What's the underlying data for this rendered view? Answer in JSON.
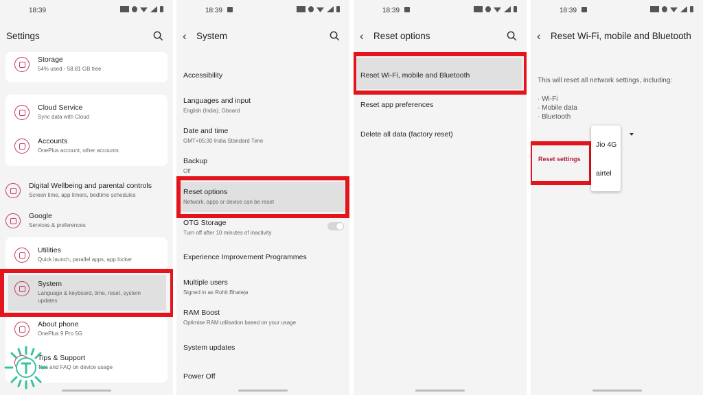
{
  "status_time": "18:39",
  "settings": {
    "title": "Settings",
    "items": [
      {
        "title": "Storage",
        "subtitle": "54% used - 58.81 GB free"
      },
      {
        "title": "Cloud Service",
        "subtitle": "Sync data with Cloud"
      },
      {
        "title": "Accounts",
        "subtitle": "OnePlus account, other accounts"
      },
      {
        "title": "Digital Wellbeing and parental controls",
        "subtitle": "Screen time, app timers, bedtime schedules"
      },
      {
        "title": "Google",
        "subtitle": "Services & preferences"
      },
      {
        "title": "Utilities",
        "subtitle": "Quick launch, parallel apps, app locker"
      },
      {
        "title": "System",
        "subtitle_line1": "Language & keyboard, time, reset, system",
        "subtitle_line2": "updates"
      },
      {
        "title": "About phone",
        "subtitle": "OnePlus 9 Pro 5G"
      },
      {
        "title": "Tips & Support",
        "subtitle": "Tips and FAQ on device usage"
      }
    ]
  },
  "system": {
    "title": "System",
    "items": [
      {
        "title": "Accessibility"
      },
      {
        "title": "Languages and input",
        "subtitle": "English (India), Gboard"
      },
      {
        "title": "Date and time",
        "subtitle": "GMT+05:30 India Standard Time"
      },
      {
        "title": "Backup",
        "subtitle": "Off"
      },
      {
        "title": "Reset options",
        "subtitle": "Network, apps or device can be reset"
      },
      {
        "title": "OTG Storage",
        "subtitle": "Turn off after 10 minutes of inactivity"
      },
      {
        "title": "Experience Improvement Programmes"
      },
      {
        "title": "Multiple users",
        "subtitle": "Signed in as Rohit Bhateja"
      },
      {
        "title": "RAM Boost",
        "subtitle": "Optimise RAM utilisation based on your usage"
      },
      {
        "title": "System updates"
      },
      {
        "title": "Power Off"
      }
    ],
    "otg_toggle_on": false
  },
  "reset": {
    "title": "Reset options",
    "items": [
      {
        "title": "Reset Wi-Fi, mobile and Bluetooth"
      },
      {
        "title": "Reset app preferences"
      },
      {
        "title": "Delete all data (factory reset)"
      }
    ]
  },
  "network_reset": {
    "title": "Reset Wi-Fi, mobile and Bluetooth",
    "description": "This will reset all network settings, including:",
    "bullets": [
      "· Wi-Fi",
      "· Mobile data",
      "· Bluetooth"
    ],
    "button_label": "Reset settings",
    "dropdown_options": [
      "Jio 4G",
      "airtel"
    ]
  },
  "colors": {
    "highlight": "#e3141c",
    "accent": "#c0395a"
  }
}
